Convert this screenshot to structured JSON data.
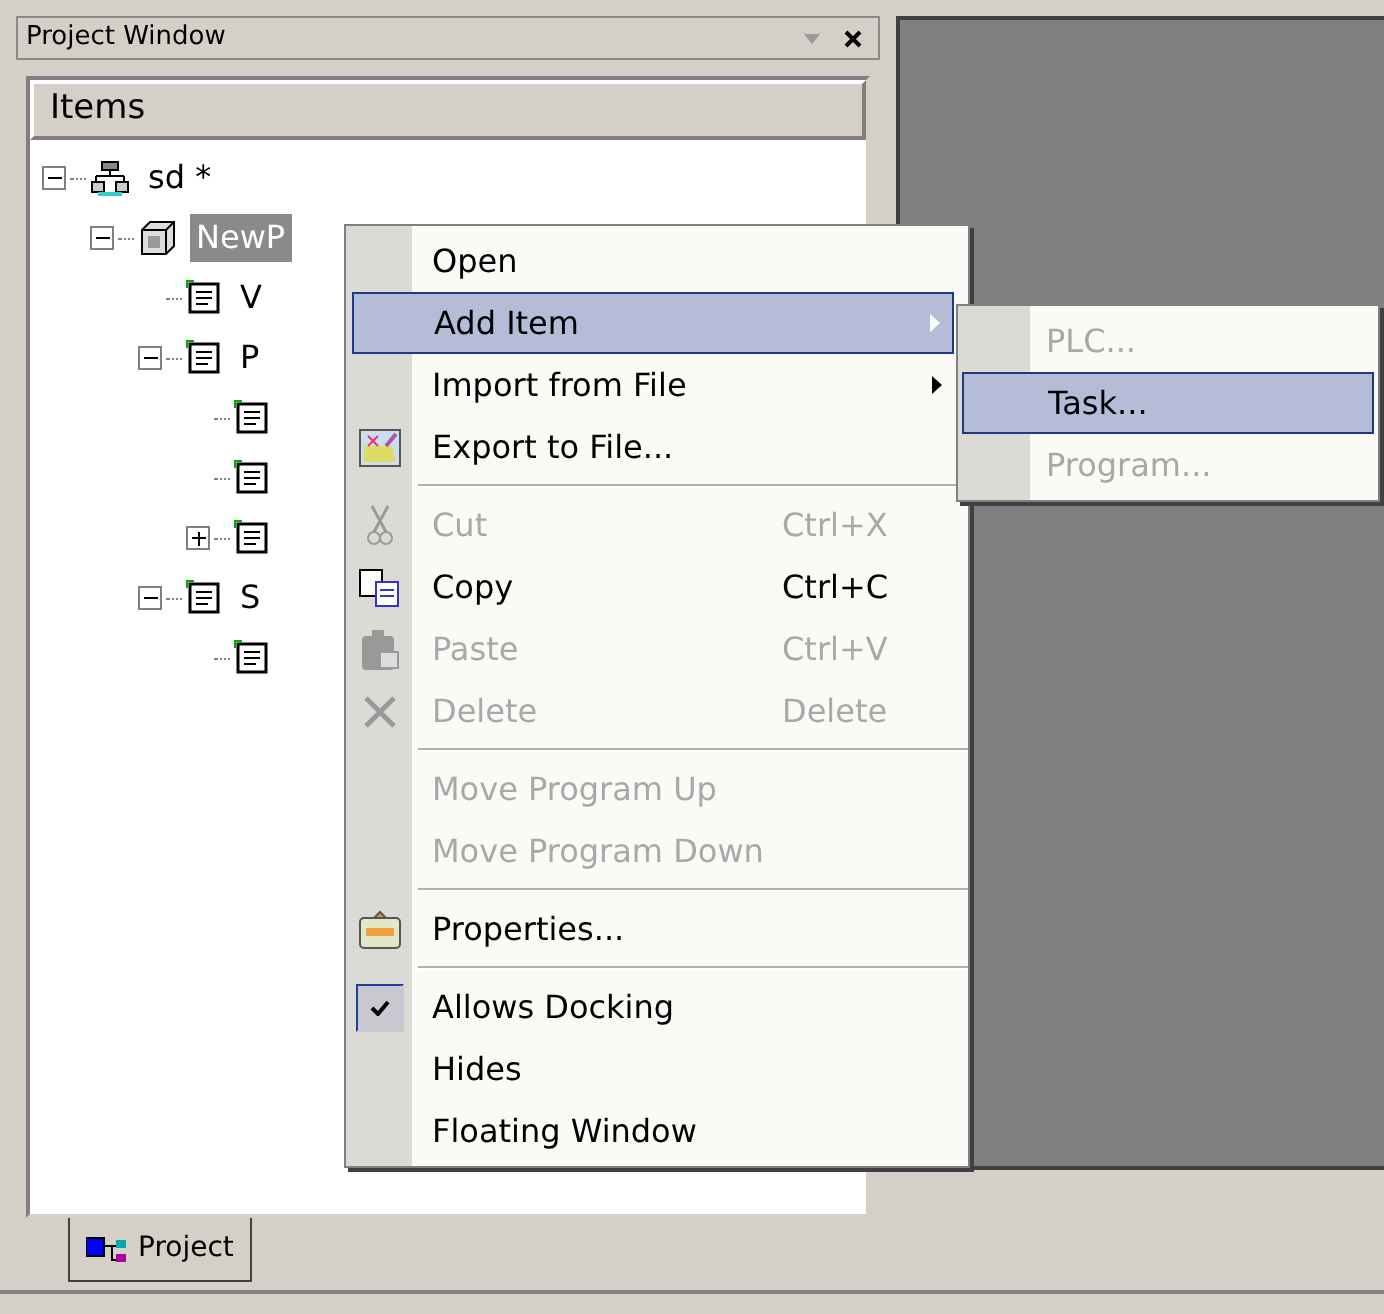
{
  "panel": {
    "title": "Project Window",
    "header": "Items"
  },
  "tree": [
    {
      "kind": "network",
      "label": "sd *",
      "expanded": true,
      "selected": false,
      "children": [
        {
          "kind": "plc",
          "label": "NewP",
          "expanded": true,
          "selected": true,
          "children": [
            {
              "kind": "document",
              "label": "V",
              "selected": false
            },
            {
              "kind": "document",
              "label": "P",
              "expanded": true,
              "selected": false,
              "children": [
                {
                  "kind": "document"
                },
                {
                  "kind": "document"
                },
                {
                  "kind": "document",
                  "expanded": false
                }
              ]
            },
            {
              "kind": "document",
              "label": "S",
              "expanded": true,
              "selected": false,
              "children": [
                {
                  "kind": "document"
                }
              ]
            }
          ]
        }
      ]
    }
  ],
  "bottom_tab": {
    "label": "Project",
    "selected": true
  },
  "context_menu": [
    {
      "kind": "item",
      "label": "Open",
      "disabled": false,
      "selected": false
    },
    {
      "kind": "item",
      "label": "Add Item",
      "disabled": false,
      "selected": true,
      "submenu": true
    },
    {
      "kind": "item",
      "label": "Import from File",
      "disabled": false,
      "selected": false,
      "submenu": true
    },
    {
      "kind": "item",
      "label": "Export to File...",
      "disabled": false,
      "selected": false
    },
    {
      "kind": "separator"
    },
    {
      "kind": "item",
      "label": "Cut",
      "shortcut": "Ctrl+X",
      "disabled": true,
      "selected": false
    },
    {
      "kind": "item",
      "label": "Copy",
      "shortcut": "Ctrl+C",
      "disabled": false,
      "selected": false
    },
    {
      "kind": "item",
      "label": "Paste",
      "shortcut": "Ctrl+V",
      "disabled": true,
      "selected": false
    },
    {
      "kind": "item",
      "label": "Delete",
      "shortcut": "Delete",
      "disabled": true,
      "selected": false
    },
    {
      "kind": "separator"
    },
    {
      "kind": "item",
      "label": "Move Program Up",
      "disabled": true,
      "selected": false
    },
    {
      "kind": "item",
      "label": "Move Program Down",
      "disabled": true,
      "selected": false
    },
    {
      "kind": "separator"
    },
    {
      "kind": "item",
      "label": "Properties...",
      "disabled": false,
      "selected": false
    },
    {
      "kind": "separator"
    },
    {
      "kind": "item",
      "label": "Allows Docking",
      "disabled": false,
      "selected": false,
      "checked": true
    },
    {
      "kind": "item",
      "label": "Hides",
      "disabled": false,
      "selected": false,
      "checked": false
    },
    {
      "kind": "item",
      "label": "Floating Window",
      "disabled": false,
      "selected": false,
      "checked": false
    }
  ],
  "submenu": [
    {
      "label": "PLC...",
      "disabled": true,
      "selected": false
    },
    {
      "label": "Task...",
      "disabled": false,
      "selected": true
    },
    {
      "label": "Program...",
      "disabled": true,
      "selected": false
    }
  ]
}
